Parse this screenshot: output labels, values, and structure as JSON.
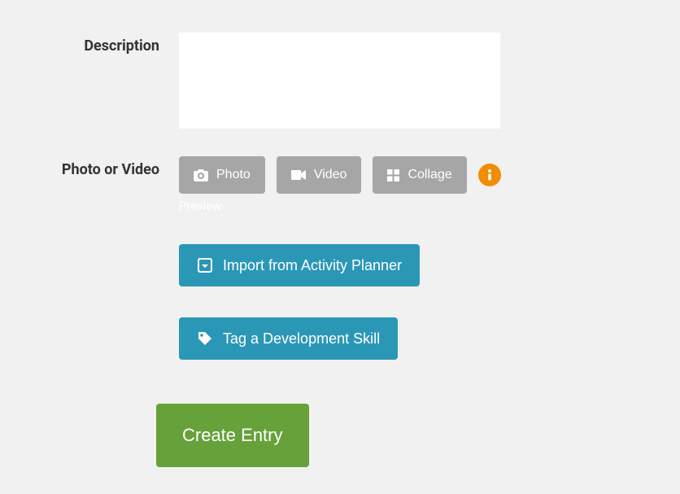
{
  "description": {
    "label": "Description",
    "value": ""
  },
  "media": {
    "label": "Photo or Video",
    "photo_label": "Photo",
    "video_label": "Video",
    "collage_label": "Collage",
    "preview_label": "Preview"
  },
  "actions": {
    "import_label": "Import from Activity Planner",
    "tag_label": "Tag a Development Skill"
  },
  "submit": {
    "label": "Create Entry"
  }
}
